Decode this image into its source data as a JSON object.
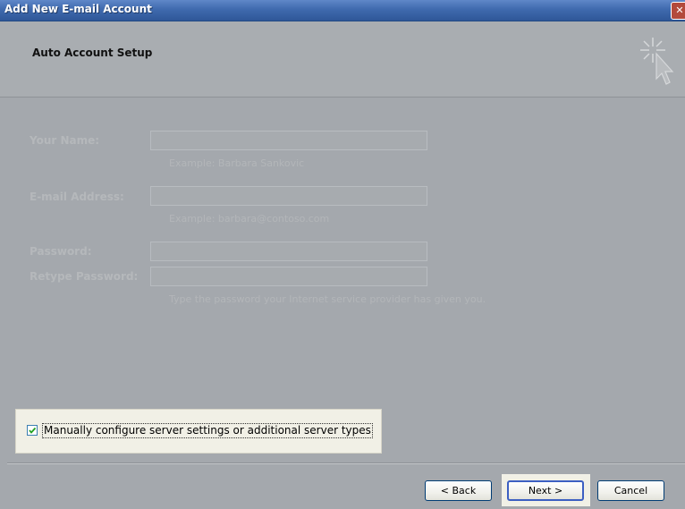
{
  "window": {
    "title": "Add New E-mail Account",
    "close_glyph": "✕"
  },
  "header": {
    "title": "Auto Account Setup",
    "icon": "wizard-cursor-icon"
  },
  "form": {
    "name_label": "Your Name:",
    "name_value": "",
    "name_hint": "Example: Barbara Sankovic",
    "email_label": "E-mail Address:",
    "email_value": "",
    "email_hint": "Example: barbara@contoso.com",
    "password_label": "Password:",
    "password_value": "",
    "retype_label": "Retype Password:",
    "retype_value": "",
    "password_hint": "Type the password your Internet service provider has given you."
  },
  "manual_config": {
    "label": "Manually configure server settings or additional server types",
    "checked": true
  },
  "buttons": {
    "back": "< Back",
    "next": "Next >",
    "cancel": "Cancel"
  },
  "colors": {
    "titlebar": "#3f6aae",
    "dialog_bg": "#a4a8ad",
    "highlight": "#f1f0e6",
    "disabled_text": "#b5b8bb"
  }
}
